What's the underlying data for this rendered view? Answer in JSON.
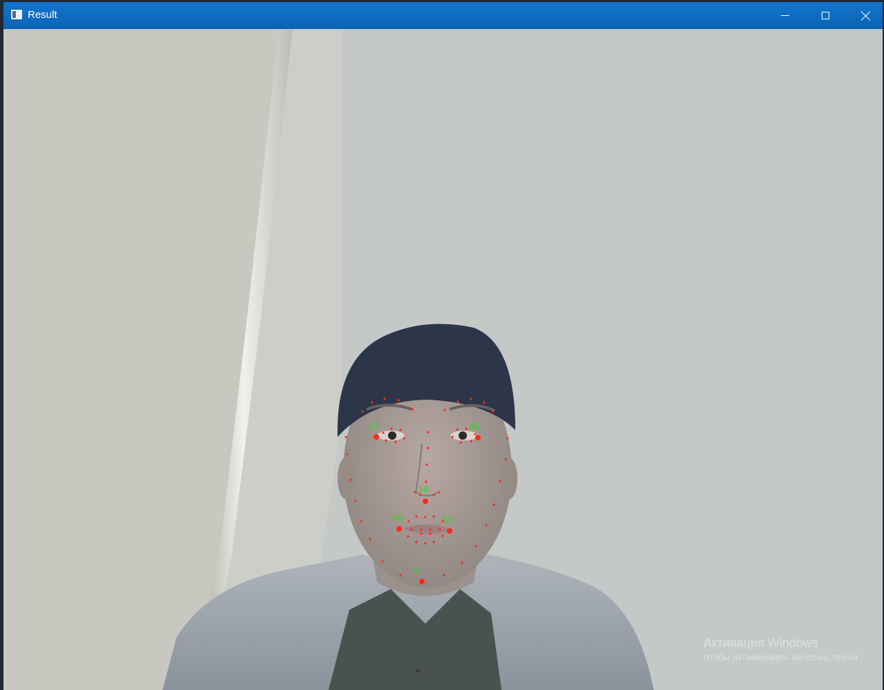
{
  "window": {
    "title": "Result",
    "titlebar_color": "#0e65b7",
    "controls": [
      "minimize-icon",
      "maximize-icon",
      "close-icon"
    ]
  },
  "landmarks": {
    "point_color": "#ff2a1a",
    "label_color": "#39d12e",
    "labeled_points": [
      "37",
      "46",
      "34",
      "49",
      "55",
      "9"
    ]
  },
  "watermark": {
    "title": "Активация Windows",
    "subtitle": "Чтобы активировать Windows, перей"
  }
}
